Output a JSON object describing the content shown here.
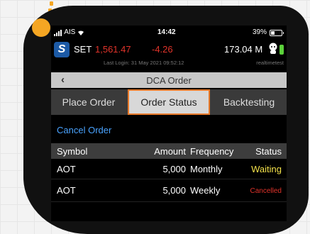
{
  "status_bar": {
    "carrier": "AIS",
    "time": "14:42",
    "battery_percent": "39%",
    "battery_level": 0.39
  },
  "market": {
    "index_name": "SET",
    "index_value": "1,561.47",
    "index_change": "-4.26",
    "volume": "173.04 M",
    "last_login": "Last Login: 31 May 2021 09:52:12",
    "user": "realtimetest",
    "colors": {
      "down": "#e0332a",
      "indicator": "#5bd13a"
    }
  },
  "header": {
    "back_icon": "chevron-left-icon",
    "title": "DCA Order"
  },
  "tabs": [
    {
      "label": "Place Order",
      "active": false
    },
    {
      "label": "Order Status",
      "active": true
    },
    {
      "label": "Backtesting",
      "active": false
    }
  ],
  "cancel_order_label": "Cancel Order",
  "table": {
    "columns": [
      "Symbol",
      "Amount",
      "Frequency",
      "Status"
    ],
    "rows": [
      {
        "symbol": "AOT",
        "amount": "5,000",
        "frequency": "Monthly",
        "status": "Waiting",
        "status_color": "#f2e04a"
      },
      {
        "symbol": "AOT",
        "amount": "5,000",
        "frequency": "Weekly",
        "status": "Cancelled",
        "status_color": "#e0332a"
      }
    ]
  },
  "accent_color": "#e87a2a"
}
